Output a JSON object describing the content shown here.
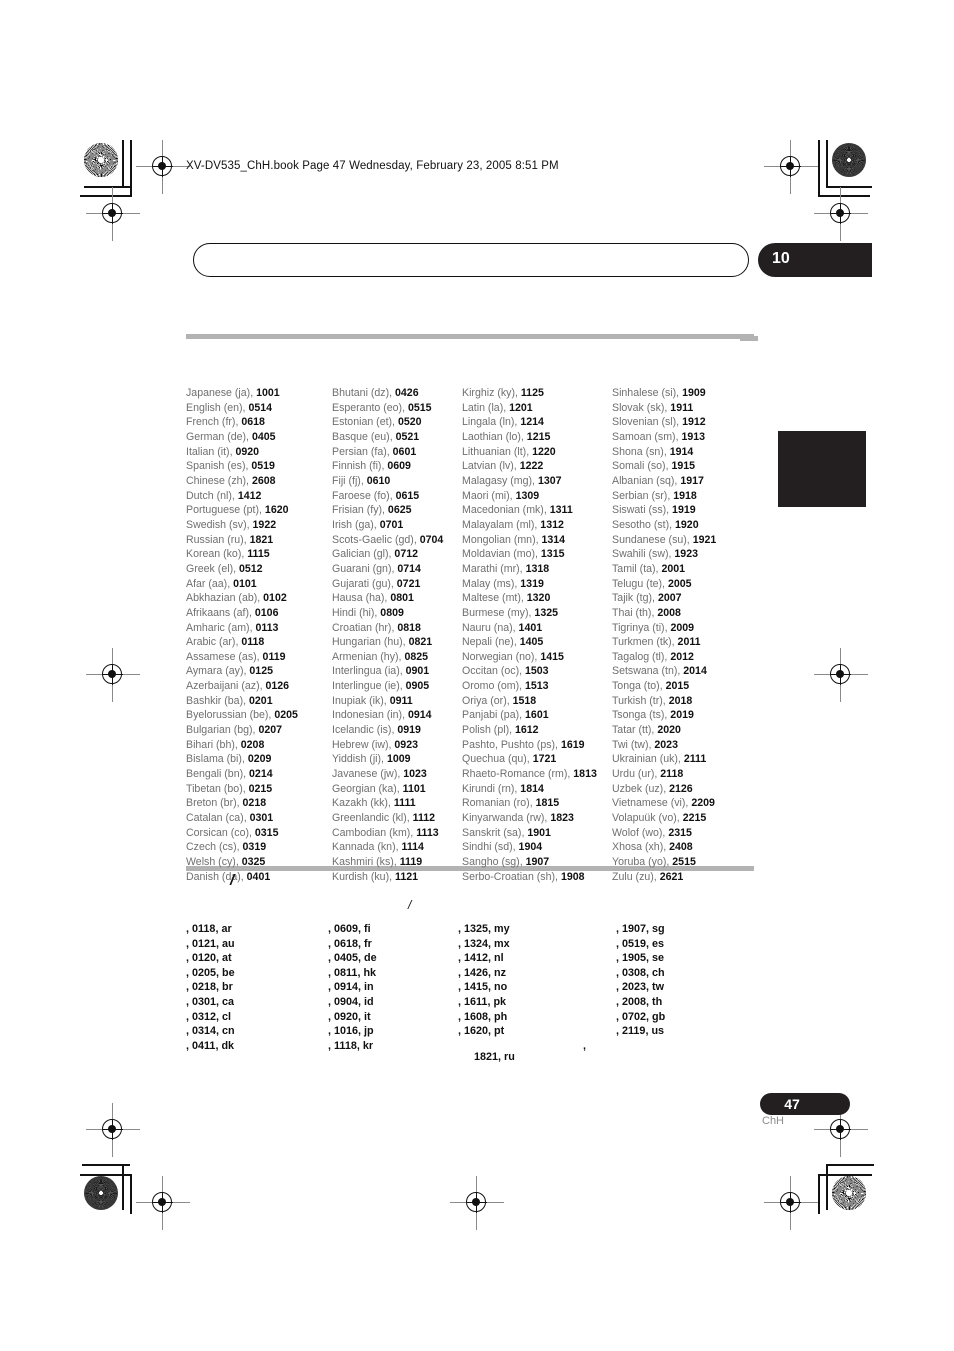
{
  "header": {
    "filename_line": "XV-DV535_ChH.book  Page 47  Wednesday, February 23, 2005  8:51 PM"
  },
  "chapter": {
    "number": "10"
  },
  "footer": {
    "page_number": "47",
    "language_code": "ChH"
  },
  "language_section": {
    "columns": [
      {
        "items": [
          {
            "name": "Japanese (ja),",
            "code": "1001"
          },
          {
            "name": "English (en),",
            "code": "0514"
          },
          {
            "name": "French (fr),",
            "code": "0618"
          },
          {
            "name": "German (de),",
            "code": "0405"
          },
          {
            "name": "Italian (it),",
            "code": "0920"
          },
          {
            "name": "Spanish (es),",
            "code": "0519"
          },
          {
            "name": "Chinese (zh),",
            "code": "2608"
          },
          {
            "name": "Dutch (nl),",
            "code": "1412"
          },
          {
            "name": "Portuguese (pt),",
            "code": "1620"
          },
          {
            "name": "Swedish (sv),",
            "code": "1922"
          },
          {
            "name": "Russian (ru),",
            "code": "1821"
          },
          {
            "name": "Korean (ko),",
            "code": "1115"
          },
          {
            "name": "Greek (el),",
            "code": "0512"
          },
          {
            "name": "Afar (aa),",
            "code": "0101"
          },
          {
            "name": "Abkhazian (ab),",
            "code": "0102"
          },
          {
            "name": "Afrikaans (af),",
            "code": "0106"
          },
          {
            "name": "Amharic (am),",
            "code": "0113"
          },
          {
            "name": "Arabic (ar),",
            "code": "0118"
          },
          {
            "name": "Assamese (as),",
            "code": "0119"
          },
          {
            "name": "Aymara (ay),",
            "code": "0125"
          },
          {
            "name": "Azerbaijani (az),",
            "code": "0126"
          },
          {
            "name": "Bashkir (ba),",
            "code": "0201"
          },
          {
            "name": "Byelorussian (be),",
            "code": "0205"
          },
          {
            "name": "Bulgarian (bg),",
            "code": "0207"
          },
          {
            "name": "Bihari (bh),",
            "code": "0208"
          },
          {
            "name": "Bislama (bi),",
            "code": "0209"
          },
          {
            "name": "Bengali (bn),",
            "code": "0214"
          },
          {
            "name": "Tibetan (bo),",
            "code": "0215"
          },
          {
            "name": "Breton (br),",
            "code": "0218"
          },
          {
            "name": "Catalan (ca),",
            "code": "0301"
          },
          {
            "name": "Corsican (co),",
            "code": "0315"
          },
          {
            "name": "Czech (cs),",
            "code": "0319"
          },
          {
            "name": "Welsh (cy),",
            "code": "0325"
          },
          {
            "name": "Danish (da),",
            "code": "0401"
          }
        ]
      },
      {
        "items": [
          {
            "name": "Bhutani (dz),",
            "code": "0426"
          },
          {
            "name": "Esperanto (eo),",
            "code": "0515"
          },
          {
            "name": "Estonian (et),",
            "code": "0520"
          },
          {
            "name": "Basque (eu),",
            "code": "0521"
          },
          {
            "name": "Persian (fa),",
            "code": "0601"
          },
          {
            "name": "Finnish (fi),",
            "code": "0609"
          },
          {
            "name": "Fiji (fj),",
            "code": "0610"
          },
          {
            "name": "Faroese (fo),",
            "code": "0615"
          },
          {
            "name": "Frisian (fy),",
            "code": "0625"
          },
          {
            "name": "Irish (ga),",
            "code": "0701"
          },
          {
            "name": "Scots-Gaelic (gd),",
            "code": "0704"
          },
          {
            "name": "Galician (gl),",
            "code": "0712"
          },
          {
            "name": "Guarani (gn),",
            "code": "0714"
          },
          {
            "name": "Gujarati (gu),",
            "code": "0721"
          },
          {
            "name": "Hausa (ha),",
            "code": "0801"
          },
          {
            "name": "Hindi (hi),",
            "code": "0809"
          },
          {
            "name": "Croatian (hr),",
            "code": "0818"
          },
          {
            "name": "Hungarian (hu),",
            "code": "0821"
          },
          {
            "name": "Armenian (hy),",
            "code": "0825"
          },
          {
            "name": "Interlingua (ia),",
            "code": "0901"
          },
          {
            "name": "Interlingue (ie),",
            "code": "0905"
          },
          {
            "name": "Inupiak (ik),",
            "code": "0911"
          },
          {
            "name": "Indonesian (in),",
            "code": "0914"
          },
          {
            "name": "Icelandic (is),",
            "code": "0919"
          },
          {
            "name": "Hebrew (iw),",
            "code": "0923"
          },
          {
            "name": "Yiddish (ji),",
            "code": "1009"
          },
          {
            "name": "Javanese (jw),",
            "code": "1023"
          },
          {
            "name": "Georgian (ka),",
            "code": "1101"
          },
          {
            "name": "Kazakh (kk),",
            "code": "1111"
          },
          {
            "name": "Greenlandic  (kl),",
            "code": "1112"
          },
          {
            "name": "Cambodian (km),",
            "code": "1113"
          },
          {
            "name": "Kannada (kn),",
            "code": "1114"
          },
          {
            "name": "Kashmiri (ks),",
            "code": "1119"
          },
          {
            "name": "Kurdish (ku),",
            "code": "1121"
          }
        ]
      },
      {
        "items": [
          {
            "name": "Kirghiz (ky),",
            "code": "1125"
          },
          {
            "name": "Latin (la),",
            "code": "1201"
          },
          {
            "name": "Lingala (ln),",
            "code": "1214"
          },
          {
            "name": "Laothian (lo),",
            "code": "1215"
          },
          {
            "name": "Lithuanian (lt),",
            "code": "1220"
          },
          {
            "name": "Latvian (lv),",
            "code": "1222"
          },
          {
            "name": "Malagasy (mg),",
            "code": "1307"
          },
          {
            "name": "Maori (mi),",
            "code": "1309"
          },
          {
            "name": "Macedonian (mk),",
            "code": "1311"
          },
          {
            "name": "Malayalam  (ml),",
            "code": "1312"
          },
          {
            "name": "Mongolian (mn),",
            "code": "1314"
          },
          {
            "name": "Moldavian (mo),",
            "code": "1315"
          },
          {
            "name": "Marathi (mr),",
            "code": "1318"
          },
          {
            "name": "Malay  (ms),",
            "code": "1319"
          },
          {
            "name": "Maltese (mt),",
            "code": "1320"
          },
          {
            "name": "Burmese (my),",
            "code": "1325"
          },
          {
            "name": "Nauru (na),",
            "code": "1401"
          },
          {
            "name": "Nepali (ne),",
            "code": "1405"
          },
          {
            "name": "Norwegian (no),",
            "code": "1415"
          },
          {
            "name": "Occitan (oc),",
            "code": "1503"
          },
          {
            "name": "Oromo (om),",
            "code": "1513"
          },
          {
            "name": "Oriya (or),",
            "code": "1518"
          },
          {
            "name": "Panjabi (pa),",
            "code": "1601"
          },
          {
            "name": "Polish (pl),",
            "code": "1612"
          },
          {
            "name": "Pashto, Pushto (ps),",
            "code": "1619"
          },
          {
            "name": "Quechua (qu),",
            "code": "1721"
          },
          {
            "name": "Rhaeto-Romance (rm),",
            "code": "1813"
          },
          {
            "name": "Kirundi (rn),",
            "code": "1814"
          },
          {
            "name": "Romanian (ro),",
            "code": "1815"
          },
          {
            "name": "Kinyarwanda (rw),",
            "code": "1823"
          },
          {
            "name": "Sanskrit (sa),",
            "code": "1901"
          },
          {
            "name": "Sindhi (sd),",
            "code": "1904"
          },
          {
            "name": "Sangho (sg),",
            "code": "1907"
          },
          {
            "name": "Serbo-Croatian (sh),",
            "code": "1908"
          }
        ]
      },
      {
        "items": [
          {
            "name": "Sinhalese (si),",
            "code": "1909"
          },
          {
            "name": "Slovak (sk),",
            "code": "1911"
          },
          {
            "name": "Slovenian (sl),",
            "code": "1912"
          },
          {
            "name": "Samoan (sm),",
            "code": "1913"
          },
          {
            "name": "Shona (sn),",
            "code": "1914"
          },
          {
            "name": "Somali (so),",
            "code": "1915"
          },
          {
            "name": "Albanian (sq),",
            "code": "1917"
          },
          {
            "name": "Serbian (sr),",
            "code": "1918"
          },
          {
            "name": "Siswati (ss),",
            "code": "1919"
          },
          {
            "name": "Sesotho (st),",
            "code": "1920"
          },
          {
            "name": "Sundanese (su),",
            "code": "1921"
          },
          {
            "name": "Swahili (sw),",
            "code": "1923"
          },
          {
            "name": "Tamil (ta),",
            "code": "2001"
          },
          {
            "name": "Telugu (te),",
            "code": "2005"
          },
          {
            "name": "Tajik (tg),",
            "code": "2007"
          },
          {
            "name": "Thai (th),",
            "code": "2008"
          },
          {
            "name": "Tigrinya (ti),",
            "code": "2009"
          },
          {
            "name": "Turkmen (tk),",
            "code": "2011"
          },
          {
            "name": "Tagalog (tl),",
            "code": "2012"
          },
          {
            "name": "Setswana (tn),",
            "code": "2014"
          },
          {
            "name": "Tonga (to),",
            "code": "2015"
          },
          {
            "name": "Turkish (tr),",
            "code": "2018"
          },
          {
            "name": "Tsonga (ts),",
            "code": "2019"
          },
          {
            "name": "Tatar (tt),",
            "code": "2020"
          },
          {
            "name": "Twi (tw),",
            "code": "2023"
          },
          {
            "name": "Ukrainian (uk),",
            "code": "2111"
          },
          {
            "name": "Urdu (ur),",
            "code": "2118"
          },
          {
            "name": "Uzbek (uz),",
            "code": "2126"
          },
          {
            "name": "Vietnamese (vi),",
            "code": "2209"
          },
          {
            "name": "Volapuük (vo),",
            "code": "2215"
          },
          {
            "name": "Wolof (wo),",
            "code": "2315"
          },
          {
            "name": "Xhosa (xh),",
            "code": "2408"
          },
          {
            "name": "Yoruba (yo),",
            "code": "2515"
          },
          {
            "name": "Zulu (zu),",
            "code": "2621"
          }
        ]
      }
    ]
  },
  "country_section": {
    "heading_a": "/",
    "heading_b": "/",
    "columns": [
      {
        "items": [
          {
            "name": "",
            "code": "0118",
            "abbr": "ar"
          },
          {
            "name": "",
            "code": "0121",
            "abbr": "au"
          },
          {
            "name": "",
            "code": "0120",
            "abbr": "at"
          },
          {
            "name": "",
            "code": "0205",
            "abbr": "be"
          },
          {
            "name": "",
            "code": "0218",
            "abbr": "br"
          },
          {
            "name": "",
            "code": "0301",
            "abbr": "ca"
          },
          {
            "name": "",
            "code": "0312",
            "abbr": "cl"
          },
          {
            "name": "",
            "code": "0314",
            "abbr": "cn"
          },
          {
            "name": "",
            "code": "0411",
            "abbr": "dk"
          }
        ]
      },
      {
        "items": [
          {
            "name": "",
            "code": "0609",
            "abbr": "fi"
          },
          {
            "name": "",
            "code": "0618",
            "abbr": "fr"
          },
          {
            "name": "",
            "code": "0405",
            "abbr": "de"
          },
          {
            "name": "",
            "code": "0811",
            "abbr": "hk"
          },
          {
            "name": "",
            "code": "0914",
            "abbr": "in"
          },
          {
            "name": "",
            "code": "0904",
            "abbr": "id"
          },
          {
            "name": "",
            "code": "0920",
            "abbr": "it"
          },
          {
            "name": "",
            "code": "1016",
            "abbr": "jp"
          },
          {
            "name": "",
            "code": "1118",
            "abbr": "kr"
          }
        ]
      },
      {
        "items": [
          {
            "name": "",
            "code": "1325",
            "abbr": "my"
          },
          {
            "name": "",
            "code": "1324",
            "abbr": "mx"
          },
          {
            "name": "",
            "code": "1412",
            "abbr": "nl"
          },
          {
            "name": "",
            "code": "1426",
            "abbr": "nz"
          },
          {
            "name": "",
            "code": "1415",
            "abbr": "no"
          },
          {
            "name": "",
            "code": "1611",
            "abbr": "pk"
          },
          {
            "name": "",
            "code": "1608",
            "abbr": "ph"
          },
          {
            "name": "",
            "code": "1620",
            "abbr": "pt"
          }
        ]
      },
      {
        "items": [
          {
            "name": "",
            "code": "1907",
            "abbr": "sg"
          },
          {
            "name": "",
            "code": "0519",
            "abbr": "es"
          },
          {
            "name": "",
            "code": "1905",
            "abbr": "se"
          },
          {
            "name": "",
            "code": "0308",
            "abbr": "ch"
          },
          {
            "name": "",
            "code": "2023",
            "abbr": "tw"
          },
          {
            "name": "",
            "code": "2008",
            "abbr": "th"
          },
          {
            "name": "",
            "code": "0702",
            "abbr": "gb"
          },
          {
            "name": "",
            "code": "2119",
            "abbr": "us"
          }
        ]
      }
    ],
    "last_row": {
      "code": "1821",
      "abbr": "ru"
    },
    "stray_mark": ","
  },
  "colors": {
    "ink_black": "#231f20",
    "rule_gray": "#b3b3b3",
    "body_gray": "#6f6f6f"
  }
}
